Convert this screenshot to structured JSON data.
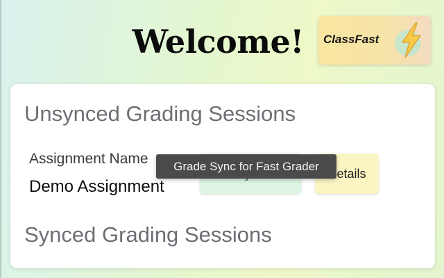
{
  "header": {
    "welcome": "Welcome!",
    "brand_name": "ClassFast",
    "brand_icon": "lightning-bolt-icon"
  },
  "unsynced": {
    "title": "Unsynced Grading Sessions",
    "assignment_label": "Assignment Name",
    "assignment_value": "Demo Assignment",
    "sync_button_label": "Sync",
    "details_button_label": "Details"
  },
  "synced": {
    "title": "Synced Grading Sessions"
  },
  "tooltip": {
    "text": "Grade Sync for Fast Grader"
  },
  "colors": {
    "sync_button_bg": "#dff5e4",
    "details_button_bg": "#fbf5c4",
    "bolt_fill": "#f7c948",
    "bolt_circle": "#bfe6cf"
  }
}
